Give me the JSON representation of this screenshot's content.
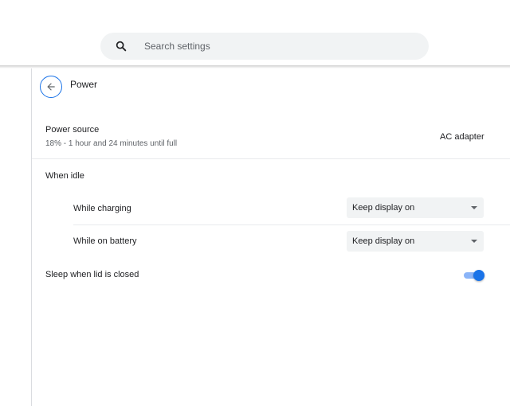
{
  "header": {
    "search": {
      "placeholder": "Search settings",
      "icon": "search-icon"
    }
  },
  "page": {
    "title": "Power",
    "back_icon": "arrow-back-icon",
    "power_source": {
      "label": "Power source",
      "status": "18% - 1 hour and 24 minutes until full",
      "value": "AC adapter"
    },
    "when_idle": {
      "label": "When idle",
      "while_charging": {
        "label": "While charging",
        "selected": "Keep display on"
      },
      "while_on_battery": {
        "label": "While on battery",
        "selected": "Keep display on"
      }
    },
    "sleep_lid": {
      "label": "Sleep when lid is closed",
      "enabled": true
    }
  },
  "colors": {
    "accent": "#1a73e8",
    "toggle_track": "#8ab4f8",
    "field_bg": "#f1f3f4",
    "divider": "#e8eaed"
  }
}
